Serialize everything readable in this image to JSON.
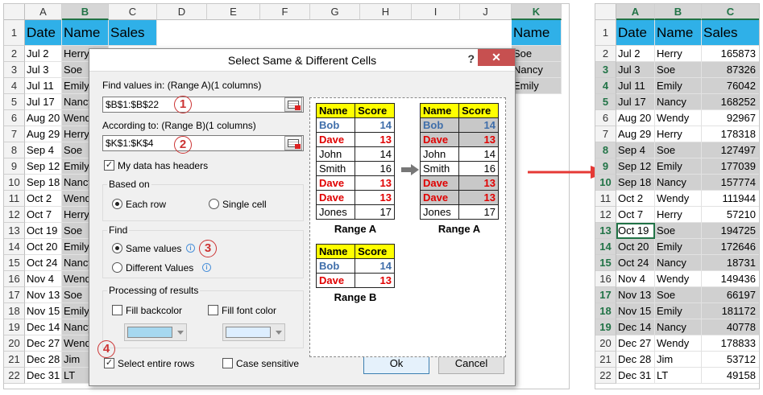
{
  "left_sheet": {
    "columns": [
      "A",
      "B",
      "C",
      "D",
      "E",
      "F",
      "G",
      "H",
      "I",
      "J",
      "K"
    ],
    "row_numbers": [
      "1",
      "2",
      "3",
      "4",
      "5",
      "6",
      "7",
      "8",
      "9",
      "10",
      "11",
      "12",
      "13",
      "14",
      "15",
      "16",
      "17",
      "18",
      "19",
      "20",
      "21",
      "22"
    ],
    "header": {
      "date": "Date",
      "name": "Name",
      "sales": "Sales"
    },
    "dates": [
      "Jul 2",
      "Jul 3",
      "Jul 11",
      "Jul 17",
      "Aug 20",
      "Aug 29",
      "Sep 4",
      "Sep 12",
      "Sep 18",
      "Oct 2",
      "Oct 7",
      "Oct 19",
      "Oct 20",
      "Oct 24",
      "Nov 4",
      "Nov 13",
      "Nov 15",
      "Dec 14",
      "Dec 27",
      "Dec 28",
      "Dec 31"
    ],
    "names_partial": [
      "Herry",
      "Soe",
      "Emily",
      "Nancy",
      "Wendy",
      "Herry",
      "Soe",
      "Emily",
      "Nancy",
      "Wendy",
      "Herry",
      "Soe",
      "Emily",
      "Nancy",
      "Wendy",
      "Soe",
      "Emily",
      "Nancy",
      "Wendy",
      "Jim",
      "LT"
    ],
    "k_header": "Name",
    "k_values": [
      "Soe",
      "Nancy",
      "Emily"
    ]
  },
  "right_sheet": {
    "columns": [
      "A",
      "B",
      "C"
    ],
    "row_numbers": [
      "1",
      "2",
      "3",
      "4",
      "5",
      "6",
      "7",
      "8",
      "9",
      "10",
      "11",
      "12",
      "13",
      "14",
      "15",
      "16",
      "17",
      "18",
      "19",
      "20",
      "21",
      "22"
    ],
    "header": {
      "date": "Date",
      "name": "Name",
      "sales": "Sales"
    },
    "rows": [
      {
        "date": "Jul 2",
        "name": "Herry",
        "sales": "165873",
        "selected": false
      },
      {
        "date": "Jul 3",
        "name": "Soe",
        "sales": "87326",
        "selected": true
      },
      {
        "date": "Jul 11",
        "name": "Emily",
        "sales": "76042",
        "selected": true
      },
      {
        "date": "Jul 17",
        "name": "Nancy",
        "sales": "168252",
        "selected": true
      },
      {
        "date": "Aug 20",
        "name": "Wendy",
        "sales": "92967",
        "selected": false
      },
      {
        "date": "Aug 29",
        "name": "Herry",
        "sales": "178318",
        "selected": false
      },
      {
        "date": "Sep 4",
        "name": "Soe",
        "sales": "127497",
        "selected": true
      },
      {
        "date": "Sep 12",
        "name": "Emily",
        "sales": "177039",
        "selected": true
      },
      {
        "date": "Sep 18",
        "name": "Nancy",
        "sales": "157774",
        "selected": true
      },
      {
        "date": "Oct 2",
        "name": "Wendy",
        "sales": "111944",
        "selected": false
      },
      {
        "date": "Oct 7",
        "name": "Herry",
        "sales": "57210",
        "selected": false
      },
      {
        "date": "Oct 19",
        "name": "Soe",
        "sales": "194725",
        "selected": true
      },
      {
        "date": "Oct 20",
        "name": "Emily",
        "sales": "172646",
        "selected": true
      },
      {
        "date": "Oct 24",
        "name": "Nancy",
        "sales": "18731",
        "selected": true
      },
      {
        "date": "Nov 4",
        "name": "Wendy",
        "sales": "149436",
        "selected": false
      },
      {
        "date": "Nov 13",
        "name": "Soe",
        "sales": "66197",
        "selected": true
      },
      {
        "date": "Nov 15",
        "name": "Emily",
        "sales": "181172",
        "selected": true
      },
      {
        "date": "Dec 14",
        "name": "Nancy",
        "sales": "40778",
        "selected": true
      },
      {
        "date": "Dec 27",
        "name": "Wendy",
        "sales": "178833",
        "selected": false
      },
      {
        "date": "Dec 28",
        "name": "Jim",
        "sales": "53712",
        "selected": false
      },
      {
        "date": "Dec 31",
        "name": "LT",
        "sales": "49158",
        "selected": false
      }
    ]
  },
  "dialog": {
    "title": "Select Same & Different Cells",
    "help": "?",
    "close": "✕",
    "find_values_label": "Find values in: (Range A)(1 columns)",
    "range_a": "$B$1:$B$22",
    "according_label": "According to: (Range B)(1 columns)",
    "range_b": "$K$1:$K$4",
    "headers_label": "My data has headers",
    "based_on": {
      "title": "Based on",
      "each_row": "Each row",
      "single_cell": "Single cell"
    },
    "find": {
      "title": "Find",
      "same": "Same values",
      "different": "Different Values"
    },
    "processing": {
      "title": "Processing of results",
      "fill_backcolor": "Fill backcolor",
      "fill_fontcolor": "Fill font color"
    },
    "select_rows": "Select entire rows",
    "case_sensitive": "Case sensitive",
    "ok": "Ok",
    "cancel": "Cancel",
    "badges": [
      "1",
      "2",
      "3",
      "4"
    ],
    "colors": {
      "backcolor": "#a6d8f0",
      "fontcolor": "#ddeeff"
    }
  },
  "preview": {
    "name_hdr": "Name",
    "score_hdr": "Score",
    "range_a_rows": [
      {
        "name": "Bob",
        "score": "14",
        "style": "bob"
      },
      {
        "name": "Dave",
        "score": "13",
        "style": "dave"
      },
      {
        "name": "John",
        "score": "14",
        "style": ""
      },
      {
        "name": "Smith",
        "score": "16",
        "style": ""
      },
      {
        "name": "Dave",
        "score": "13",
        "style": "dave"
      },
      {
        "name": "Dave",
        "score": "13",
        "style": "dave"
      },
      {
        "name": "Jones",
        "score": "17",
        "style": ""
      }
    ],
    "range_b_rows": [
      {
        "name": "Bob",
        "score": "14",
        "style": "bob"
      },
      {
        "name": "Dave",
        "score": "13",
        "style": "dave"
      }
    ],
    "caption_a": "Range A",
    "caption_a2": "Range A",
    "caption_b": "Range B"
  }
}
